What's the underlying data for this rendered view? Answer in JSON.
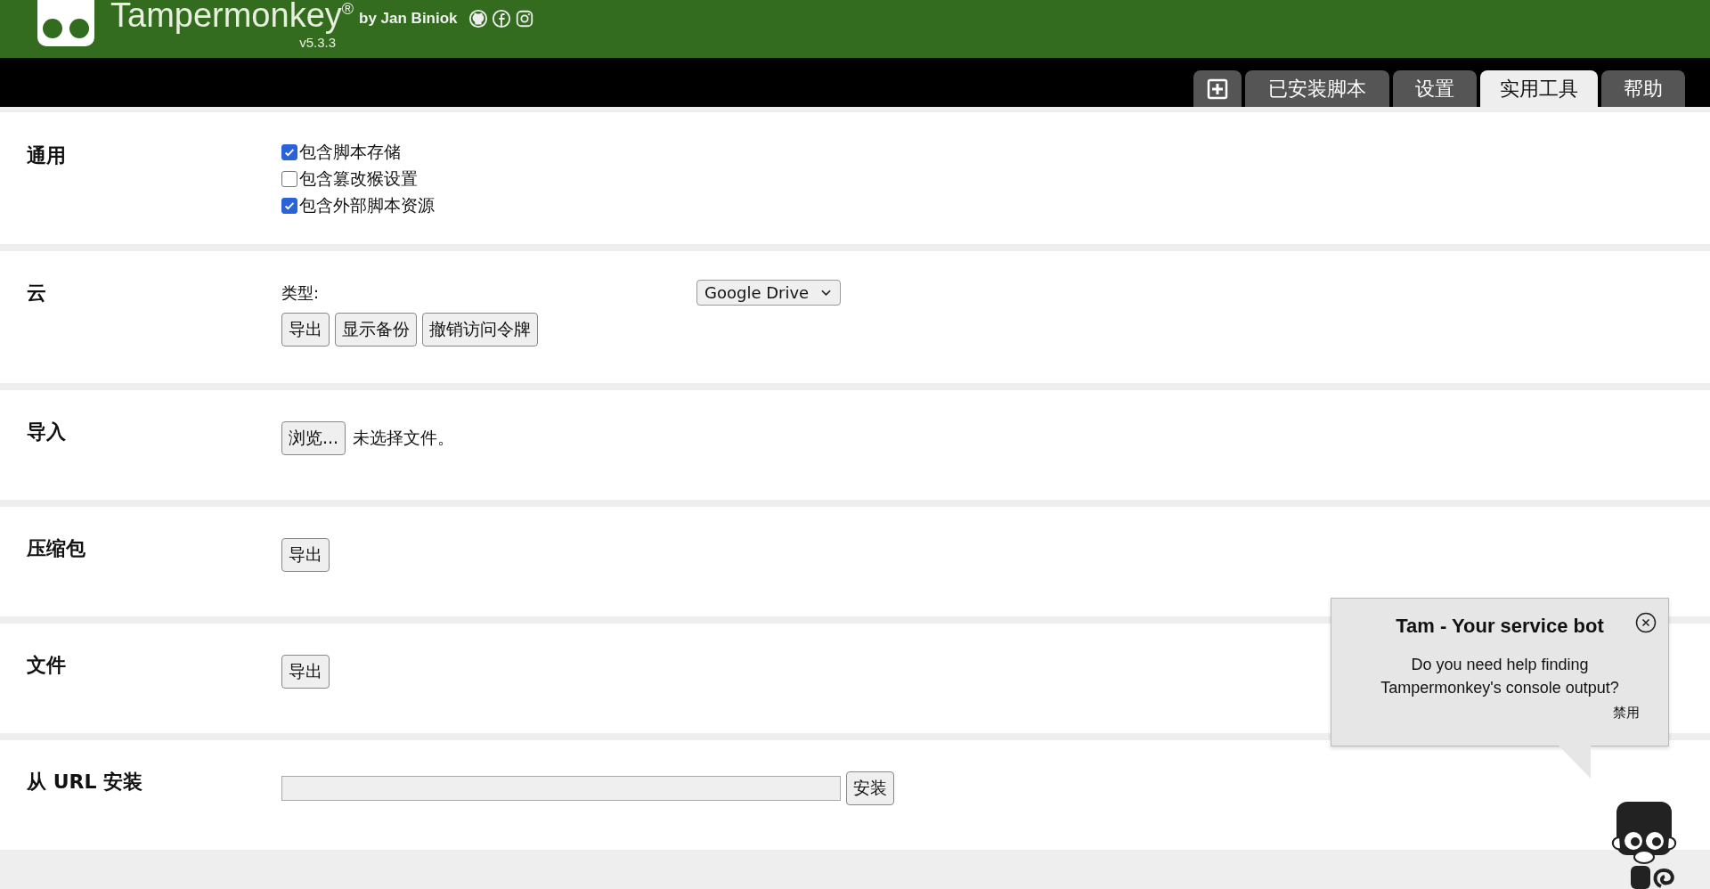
{
  "header": {
    "title": "Tampermonkey",
    "mark": "®",
    "author": "by Jan Biniok",
    "version": "v5.3.3"
  },
  "tabs": [
    {
      "kind": "add",
      "selected": false
    },
    {
      "kind": "text",
      "label": "已安装脚本",
      "selected": false
    },
    {
      "kind": "text",
      "label": "设置",
      "selected": false
    },
    {
      "kind": "text",
      "label": "实用工具",
      "selected": true
    },
    {
      "kind": "text",
      "label": "帮助",
      "selected": false
    }
  ],
  "sections": [
    {
      "title": "通用",
      "kind": "checks",
      "options": [
        {
          "label": "包含脚本存储",
          "checked": true
        },
        {
          "label": "包含篡改猴设置",
          "checked": false
        },
        {
          "label": "包含外部脚本资源",
          "checked": true
        }
      ]
    },
    {
      "title": "云",
      "kind": "cloud",
      "type_label": "类型:",
      "select": "Google Drive",
      "buttons": [
        "导出",
        "显示备份",
        "撤销访问令牌"
      ]
    },
    {
      "title": "导入",
      "kind": "file",
      "button": "浏览...",
      "status": "未选择文件。"
    },
    {
      "title": "压缩包",
      "kind": "buttons",
      "buttons": [
        "导出"
      ]
    },
    {
      "title": "文件",
      "kind": "buttons",
      "buttons": [
        "导出"
      ]
    },
    {
      "title": "从 URL 安装",
      "kind": "url",
      "button": "安装"
    }
  ],
  "bot": {
    "title": "Tam - Your service bot",
    "message": "Do you need help finding Tampermonkey's console output?",
    "link": "禁用"
  }
}
